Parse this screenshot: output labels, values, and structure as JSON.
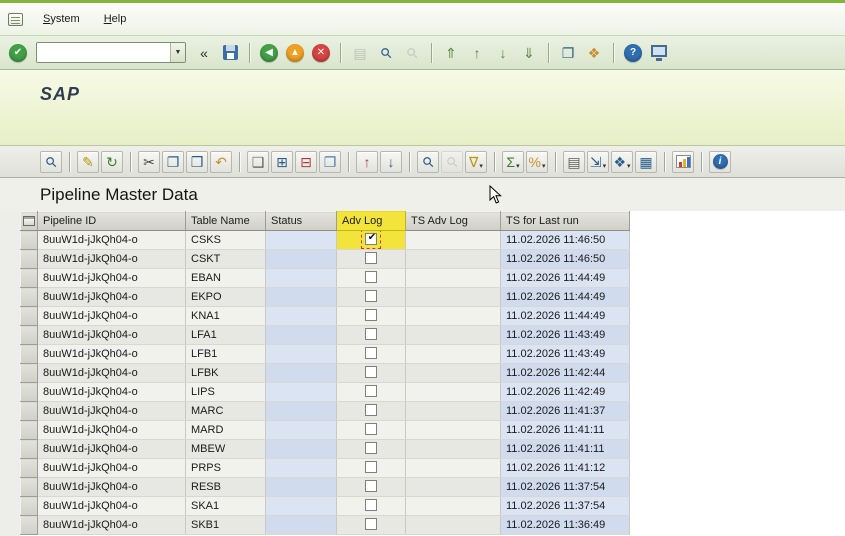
{
  "menu": {
    "items": [
      {
        "label": "System"
      },
      {
        "label": "Help"
      }
    ]
  },
  "branding": {
    "logo": "SAP"
  },
  "toolbar": {
    "command_value": "",
    "items": [
      {
        "kind": "btn",
        "name": "enter-button",
        "cls": "circ",
        "bg": "#43a047",
        "glyph": "✔"
      },
      {
        "kind": "command",
        "name": "command-field"
      },
      {
        "kind": "btn",
        "name": "collapse-command-button",
        "glyph": "«",
        "color": "#2c2c2c"
      },
      {
        "kind": "btn",
        "name": "save-button",
        "cls": "floppy"
      },
      {
        "kind": "sep"
      },
      {
        "kind": "btn",
        "name": "back-button",
        "cls": "circ",
        "bg": "#43a047",
        "glyph": "◀"
      },
      {
        "kind": "btn",
        "name": "exit-button",
        "cls": "circ",
        "bg": "#efa023",
        "glyph": "▲"
      },
      {
        "kind": "btn",
        "name": "cancel-button",
        "cls": "circ",
        "bg": "#d64541",
        "glyph": "✕"
      },
      {
        "kind": "sep"
      },
      {
        "kind": "btn",
        "name": "print-button",
        "glyph": "▤",
        "color": "#8a8a84",
        "disabled": true
      },
      {
        "kind": "btn",
        "name": "find-button",
        "glyph": "⚲",
        "cls": "rot",
        "color": "#2a5d8a"
      },
      {
        "kind": "btn",
        "name": "find-next-button",
        "glyph": "⚲",
        "cls": "rot",
        "color": "#8fa0ae",
        "disabled": true
      },
      {
        "kind": "sep"
      },
      {
        "kind": "btn",
        "name": "first-page-button",
        "glyph": "⇑",
        "color": "#57883f"
      },
      {
        "kind": "btn",
        "name": "page-up-button",
        "glyph": "↑",
        "color": "#57883f"
      },
      {
        "kind": "btn",
        "name": "page-down-button",
        "glyph": "↓",
        "color": "#57883f"
      },
      {
        "kind": "btn",
        "name": "last-page-button",
        "glyph": "⇓",
        "color": "#57883f"
      },
      {
        "kind": "sep"
      },
      {
        "kind": "btn",
        "name": "new-session-button",
        "glyph": "❐",
        "color": "#2a5d8a"
      },
      {
        "kind": "btn",
        "name": "create-shortcut-button",
        "glyph": "❖",
        "color": "#c78f2e"
      },
      {
        "kind": "sep"
      },
      {
        "kind": "btn",
        "name": "help-button",
        "cls": "circ",
        "bg": "#2f6fb2",
        "glyph": "?"
      },
      {
        "kind": "btn",
        "name": "layout-button",
        "cls": "monitor"
      }
    ]
  },
  "app_toolbar": {
    "groups": [
      [
        {
          "name": "details-button",
          "glyph": "⚲",
          "cls": "rot",
          "color": "#2a5d8a"
        }
      ],
      [
        {
          "name": "display-change-button",
          "glyph": "✎",
          "color": "#b8960a"
        },
        {
          "name": "refresh-button",
          "glyph": "↻",
          "color": "#3a7d2c"
        }
      ],
      [
        {
          "name": "cut-button",
          "glyph": "✂",
          "color": "#3d3d3d"
        },
        {
          "name": "copy-button",
          "glyph": "❐",
          "color": "#2a5d8a"
        },
        {
          "name": "paste-button",
          "glyph": "❒",
          "color": "#2a5d8a"
        },
        {
          "name": "undo-button",
          "glyph": "↶",
          "color": "#c78f2e"
        }
      ],
      [
        {
          "name": "append-row-button",
          "glyph": "❑",
          "color": "#5c5c54"
        },
        {
          "name": "insert-row-button",
          "glyph": "⊞",
          "color": "#2a5d8a"
        },
        {
          "name": "delete-row-button",
          "glyph": "⊟",
          "color": "#b03a3a"
        },
        {
          "name": "duplicate-row-button",
          "glyph": "❐",
          "color": "#4a7ab0"
        }
      ],
      [
        {
          "name": "sort-ascending-button",
          "glyph": "↑",
          "color": "#b03a3a"
        },
        {
          "name": "sort-descending-button",
          "glyph": "↓",
          "color": "#2a5d8a"
        }
      ],
      [
        {
          "name": "find-button",
          "glyph": "⚲",
          "cls": "rot",
          "color": "#2a5d8a"
        },
        {
          "name": "find-next-button",
          "glyph": "⚲",
          "cls": "rot",
          "color": "#9aa6b0",
          "disabled": true
        },
        {
          "name": "filter-button",
          "glyph": "∇",
          "color": "#b8960a",
          "dd": true
        }
      ],
      [
        {
          "name": "sum-button",
          "glyph": "Σ",
          "color": "#3a7d2c",
          "dd": true
        },
        {
          "name": "subtotal-button",
          "glyph": "%",
          "color": "#c78f2e",
          "dd": true
        }
      ],
      [
        {
          "name": "print-button",
          "glyph": "▤",
          "color": "#60605a"
        },
        {
          "name": "export-button",
          "glyph": "⇲",
          "color": "#2a5d8a",
          "dd": true
        },
        {
          "name": "views-button",
          "glyph": "❖",
          "color": "#2a5d8a",
          "dd": true
        },
        {
          "name": "table-settings-button",
          "glyph": "▦",
          "color": "#2a5d8a"
        }
      ],
      [
        {
          "name": "chart-button",
          "cls": "chart"
        }
      ],
      [
        {
          "name": "info-button",
          "cls": "circ-sm",
          "bg": "#2f6fb2",
          "glyph": "i"
        }
      ]
    ]
  },
  "page": {
    "title": "Pipeline Master Data"
  },
  "colors": {
    "highlight": "#f2e43a",
    "status_cell": "#dbe4f3"
  },
  "table": {
    "columns": [
      {
        "label": "Pipeline ID"
      },
      {
        "label": "Table Name"
      },
      {
        "label": "Status"
      },
      {
        "label": "Adv Log",
        "highlight": true
      },
      {
        "label": "TS Adv Log"
      },
      {
        "label": "TS for Last run"
      }
    ],
    "rows": [
      {
        "pipeline_id": "8uuW1d-jJkQh04-o",
        "table_name": "CSKS",
        "status": "",
        "adv_log": true,
        "adv_log_highlight": true,
        "ts_adv_log": "",
        "ts_last_run": "11.02.2026 11:46:50"
      },
      {
        "pipeline_id": "8uuW1d-jJkQh04-o",
        "table_name": "CSKT",
        "status": "",
        "adv_log": false,
        "ts_adv_log": "",
        "ts_last_run": "11.02.2026 11:46:50"
      },
      {
        "pipeline_id": "8uuW1d-jJkQh04-o",
        "table_name": "EBAN",
        "status": "",
        "adv_log": false,
        "ts_adv_log": "",
        "ts_last_run": "11.02.2026 11:44:49"
      },
      {
        "pipeline_id": "8uuW1d-jJkQh04-o",
        "table_name": "EKPO",
        "status": "",
        "adv_log": false,
        "ts_adv_log": "",
        "ts_last_run": "11.02.2026 11:44:49"
      },
      {
        "pipeline_id": "8uuW1d-jJkQh04-o",
        "table_name": "KNA1",
        "status": "",
        "adv_log": false,
        "ts_adv_log": "",
        "ts_last_run": "11.02.2026 11:44:49"
      },
      {
        "pipeline_id": "8uuW1d-jJkQh04-o",
        "table_name": "LFA1",
        "status": "",
        "adv_log": false,
        "ts_adv_log": "",
        "ts_last_run": "11.02.2026 11:43:49"
      },
      {
        "pipeline_id": "8uuW1d-jJkQh04-o",
        "table_name": "LFB1",
        "status": "",
        "adv_log": false,
        "ts_adv_log": "",
        "ts_last_run": "11.02.2026 11:43:49"
      },
      {
        "pipeline_id": "8uuW1d-jJkQh04-o",
        "table_name": "LFBK",
        "status": "",
        "adv_log": false,
        "ts_adv_log": "",
        "ts_last_run": "11.02.2026 11:42:44"
      },
      {
        "pipeline_id": "8uuW1d-jJkQh04-o",
        "table_name": "LIPS",
        "status": "",
        "adv_log": false,
        "ts_adv_log": "",
        "ts_last_run": "11.02.2026 11:42:49"
      },
      {
        "pipeline_id": "8uuW1d-jJkQh04-o",
        "table_name": "MARC",
        "status": "",
        "adv_log": false,
        "ts_adv_log": "",
        "ts_last_run": "11.02.2026 11:41:37"
      },
      {
        "pipeline_id": "8uuW1d-jJkQh04-o",
        "table_name": "MARD",
        "status": "",
        "adv_log": false,
        "ts_adv_log": "",
        "ts_last_run": "11.02.2026 11:41:11"
      },
      {
        "pipeline_id": "8uuW1d-jJkQh04-o",
        "table_name": "MBEW",
        "status": "",
        "adv_log": false,
        "ts_adv_log": "",
        "ts_last_run": "11.02.2026 11:41:11"
      },
      {
        "pipeline_id": "8uuW1d-jJkQh04-o",
        "table_name": "PRPS",
        "status": "",
        "adv_log": false,
        "ts_adv_log": "",
        "ts_last_run": "11.02.2026 11:41:12"
      },
      {
        "pipeline_id": "8uuW1d-jJkQh04-o",
        "table_name": "RESB",
        "status": "",
        "adv_log": false,
        "ts_adv_log": "",
        "ts_last_run": "11.02.2026 11:37:54"
      },
      {
        "pipeline_id": "8uuW1d-jJkQh04-o",
        "table_name": "SKA1",
        "status": "",
        "adv_log": false,
        "ts_adv_log": "",
        "ts_last_run": "11.02.2026 11:37:54"
      },
      {
        "pipeline_id": "8uuW1d-jJkQh04-o",
        "table_name": "SKB1",
        "status": "",
        "adv_log": false,
        "ts_adv_log": "",
        "ts_last_run": "11.02.2026 11:36:49"
      }
    ]
  }
}
